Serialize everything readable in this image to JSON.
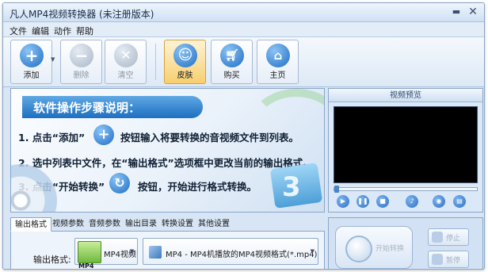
{
  "app": {
    "title": "凡人MP4视频转换器  (未注册版本)",
    "minimize_glyph": "▬",
    "close_glyph": "✕"
  },
  "menu": [
    "文件",
    "编辑",
    "动作",
    "帮助"
  ],
  "toolbar": {
    "add_label": "添加",
    "delete_label": "删除",
    "clear_label": "清空",
    "skin_label": "皮肤",
    "buy_label": "购买",
    "home_label": "主页",
    "dropdown_glyph": "▼"
  },
  "tutorial": {
    "title": "软件操作步骤说明：",
    "step1_pre": "1. 点击“添加”",
    "step1_post": "按钮输入将要转换的音视频文件到列表。",
    "step2": "2. 选中列表中文件，在“输出格式”选项框中更改当前的输出格式。",
    "step3_pre": "3. 点击“开始转换”",
    "step3_post": "按钮，开始进行格式转换。",
    "badge_number": "3"
  },
  "preview": {
    "header": "视频预览",
    "position": 0.0
  },
  "tabs": [
    "输出格式",
    "视频参数",
    "音频参数",
    "输出目录",
    "转换设置",
    "其他设置"
  ],
  "selected_tab": 0,
  "format": {
    "label": "输出格式:",
    "category": "MP4视频",
    "category_thumb_text": "MP4",
    "profile": "MP4 - MP4机播放的MP4视频格式(*.mp4)",
    "arrow_glyph": "▼"
  },
  "actions": {
    "start_label": "开始转换",
    "stop_label": "停止",
    "pause_label": "暂停"
  },
  "colors": {
    "accent_blue": "#1d6fc0",
    "active_skin_button": "#f7cf6f",
    "add_icon": "#2a7fd4",
    "disabled_icon": "#b8c4d3"
  }
}
